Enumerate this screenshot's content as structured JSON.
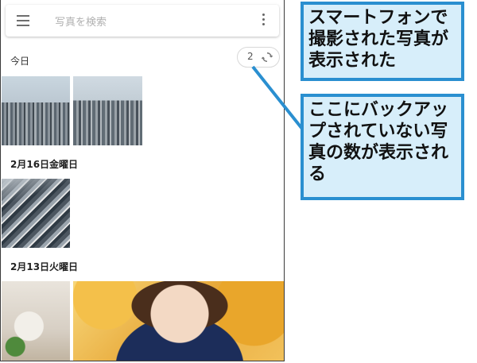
{
  "search": {
    "placeholder": "写真を検索"
  },
  "sections": [
    {
      "label": "今日"
    },
    {
      "label": "2月16日金曜日"
    },
    {
      "label": "2月13日火曜日"
    }
  ],
  "backup_chip": {
    "count": "2"
  },
  "photos": {
    "today": [
      "city-skyline-photo",
      "city-skyline-photo"
    ],
    "feb16": [
      "street-crossing-photo"
    ],
    "feb13": [
      "kitchen-photo",
      "portrait-photo"
    ]
  },
  "callouts": {
    "top": "スマートフォンで撮影された写真が表示された",
    "bottom": "ここにバックアップされていない写真の数が表示される"
  },
  "colors": {
    "callout_border": "#2a8fd0",
    "callout_fill": "#d7eefa"
  }
}
